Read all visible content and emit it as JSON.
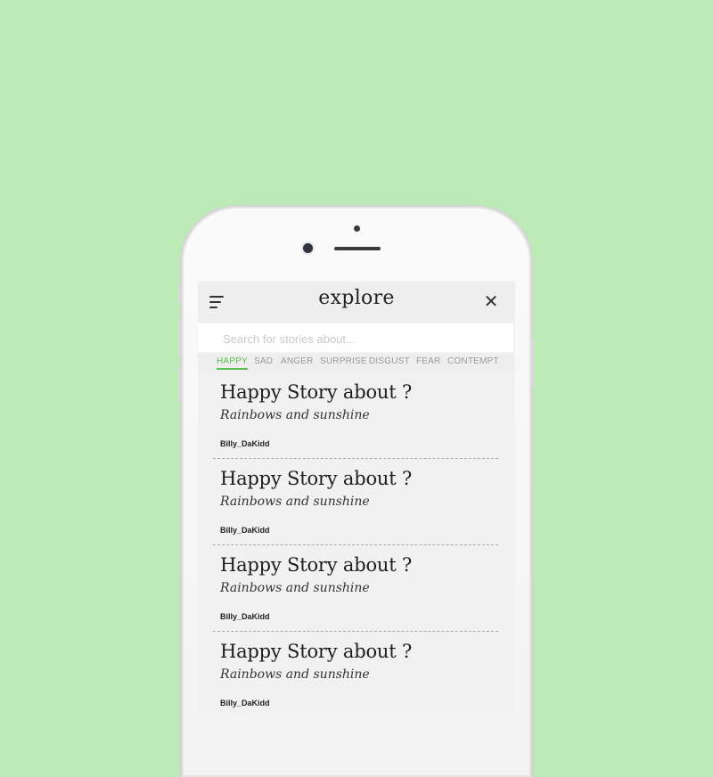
{
  "header": {
    "title": "explore"
  },
  "search": {
    "placeholder": "Search for stories about..."
  },
  "tabs": [
    {
      "label": "HAPPY",
      "active": true
    },
    {
      "label": "SAD",
      "active": false
    },
    {
      "label": "ANGER",
      "active": false
    },
    {
      "label": "SURPRISE",
      "active": false
    },
    {
      "label": "DISGUST",
      "active": false
    },
    {
      "label": "FEAR",
      "active": false
    },
    {
      "label": "CONTEMPT",
      "active": false
    }
  ],
  "stories": [
    {
      "title": "Happy Story about ?",
      "subtitle": "Rainbows and sunshine",
      "author": "Billy_DaKidd"
    },
    {
      "title": "Happy Story about ?",
      "subtitle": "Rainbows and sunshine",
      "author": "Billy_DaKidd"
    },
    {
      "title": "Happy Story about ?",
      "subtitle": "Rainbows and sunshine",
      "author": "Billy_DaKidd"
    },
    {
      "title": "Happy Story about ?",
      "subtitle": "Rainbows and sunshine",
      "author": "Billy_DaKidd"
    }
  ],
  "colors": {
    "background": "#bdebb8",
    "accent": "#5bbf52",
    "screen": "#f1f1f1"
  },
  "icons": {
    "menu": "menu-icon",
    "close": "close-icon"
  }
}
